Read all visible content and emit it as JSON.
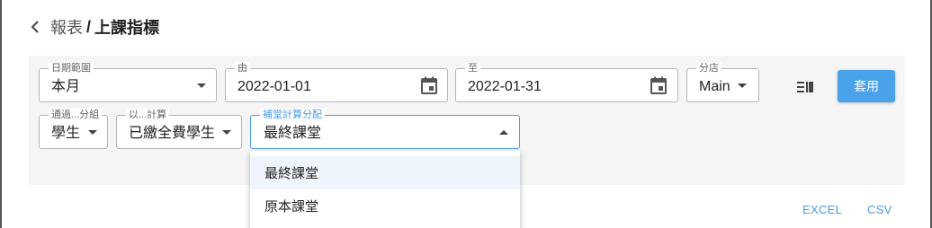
{
  "header": {
    "back_icon": "chevron-left-icon",
    "parent": "報表",
    "separator": "/",
    "title": "上課指標"
  },
  "filters": {
    "date_range": {
      "label": "日期範圍",
      "value": "本月"
    },
    "from": {
      "label": "由",
      "value": "2022-01-01"
    },
    "to": {
      "label": "至",
      "value": "2022-01-31"
    },
    "branch": {
      "label": "分店",
      "value": "Main"
    },
    "group_by": {
      "label": "通過...分組",
      "value": "學生"
    },
    "calc_by": {
      "label": "以...計算",
      "value": "已繳全費學生"
    },
    "makeup_alloc": {
      "label": "補堂計算分配",
      "value": "最終課堂"
    }
  },
  "toolbar": {
    "columns_icon": "columns-icon",
    "apply_label": "套用"
  },
  "dropdown": {
    "options": [
      "最終課堂",
      "原本課堂"
    ],
    "selected_index": 0
  },
  "export": {
    "excel_label": "EXCEL",
    "csv_label": "CSV"
  },
  "colors": {
    "accent": "#4aa3ea",
    "panel_bg": "#f5f5f5"
  }
}
